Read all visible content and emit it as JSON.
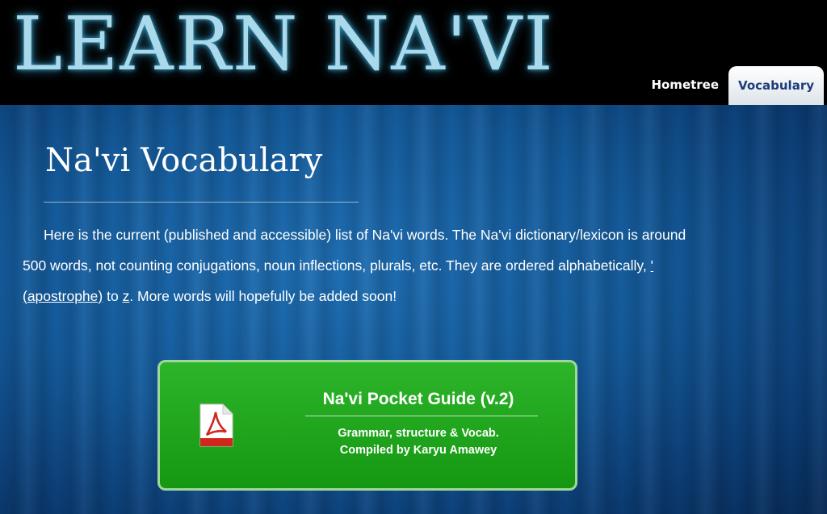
{
  "header": {
    "site_title": "LEARN NA'VI",
    "tabs": [
      {
        "label": "Hometree",
        "active": false
      },
      {
        "label": "Vocabulary",
        "active": true
      }
    ]
  },
  "main": {
    "title": "Na'vi Vocabulary",
    "intro": {
      "text_before": "Here is the current (published and accessible) list of Na'vi words. The Na'vi dictionary/lexicon is around 500 words, not counting conjugations, noun inflections, plurals, etc. They are ordered alphabetically, ",
      "link_apostrophe": "' (apostrophe)",
      "text_mid": " to ",
      "link_z": "z",
      "text_after": ". More words will hopefully be added soon!"
    },
    "guide": {
      "icon": "pdf-icon",
      "title": "Na'vi Pocket Guide (v.2)",
      "line1": "Grammar, structure & Vocab.",
      "line2": "Compiled by Karyu Amawey"
    }
  },
  "colors": {
    "title_glow": "#a9d9ea",
    "background_blue": "#145a9a",
    "button_green": "#1fa51c",
    "active_tab_text": "#1e3c7a"
  }
}
